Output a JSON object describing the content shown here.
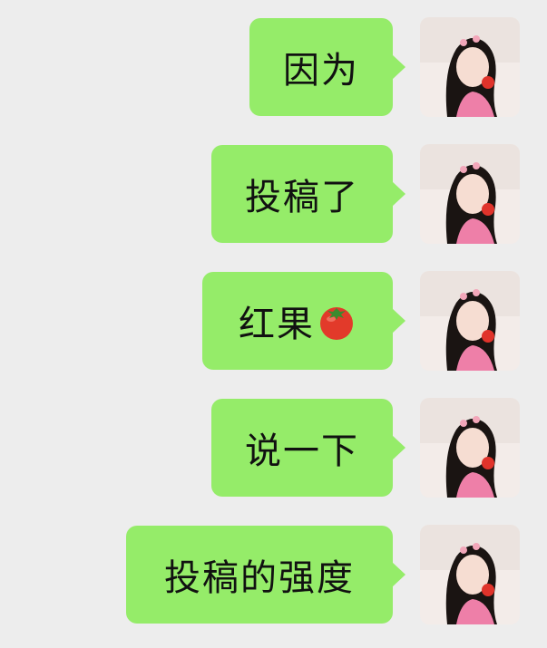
{
  "messages": [
    {
      "text": "因为",
      "emoji": ""
    },
    {
      "text": "投稿了",
      "emoji": ""
    },
    {
      "text": "红果",
      "emoji": "tomato-icon"
    },
    {
      "text": "说一下",
      "emoji": ""
    },
    {
      "text": "投稿的强度",
      "emoji": ""
    }
  ],
  "colors": {
    "background": "#ededed",
    "bubble": "#95ec69"
  }
}
